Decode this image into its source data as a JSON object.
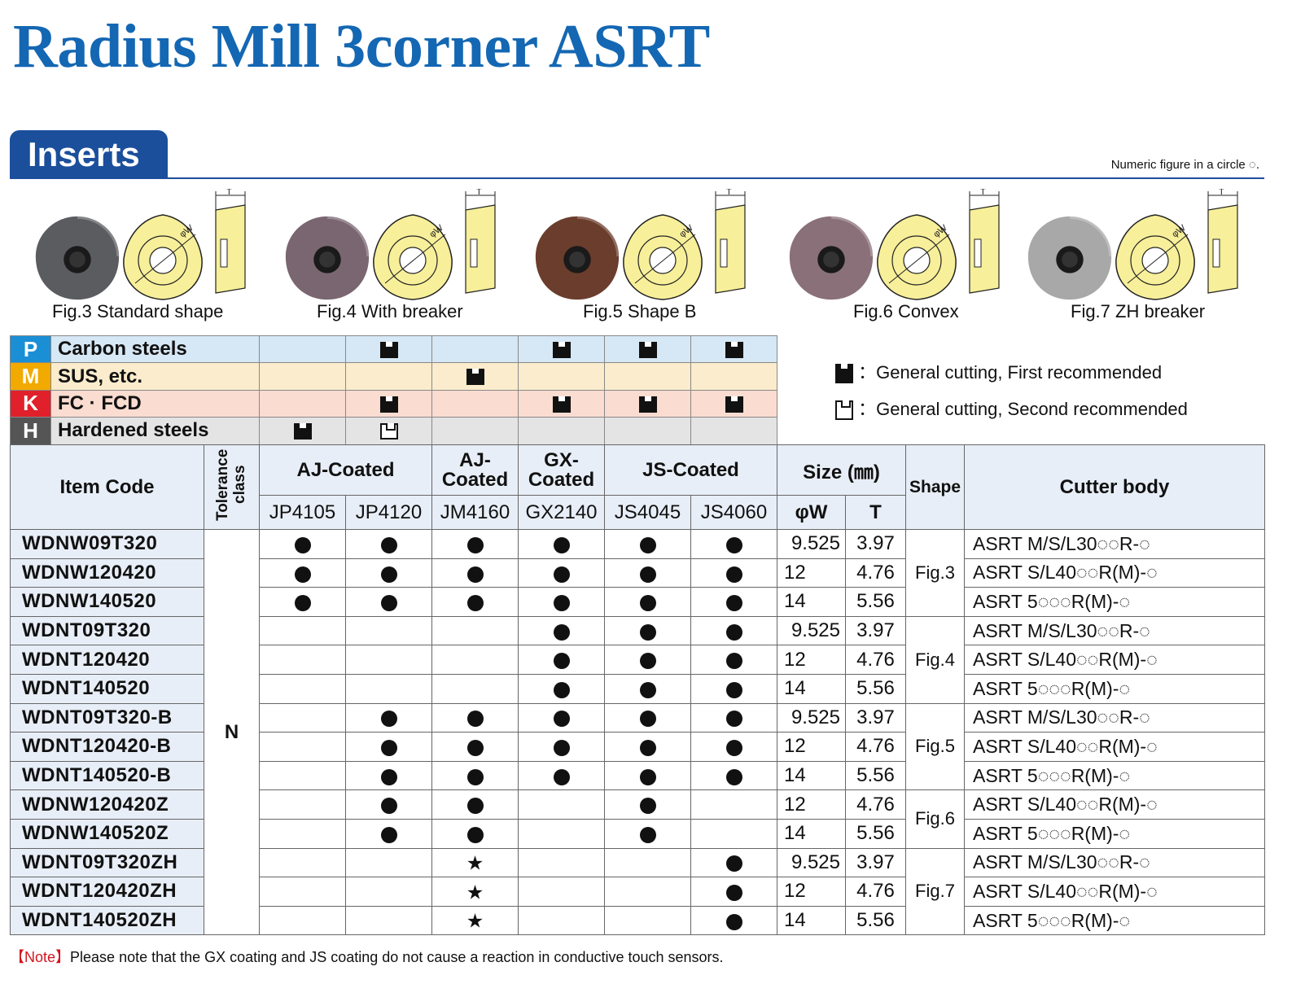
{
  "title": "Radius Mill 3corner ASRT",
  "section_tab": "Inserts",
  "circle_note": "Numeric figure in a circle ◌.",
  "figures": [
    {
      "caption": "Fig.3 Standard shape",
      "color": "#5a5c60"
    },
    {
      "caption": "Fig.4 With breaker",
      "color": "#7a6670"
    },
    {
      "caption": "Fig.5 Shape B",
      "color": "#6b3d2c"
    },
    {
      "caption": "Fig.6 Convex",
      "color": "#8a7078"
    },
    {
      "caption": "Fig.7 ZH breaker",
      "color": "#a8a8a8"
    }
  ],
  "figure_labels": {
    "t": "T",
    "w": "φW"
  },
  "materials": [
    {
      "letter": "P",
      "name": "Carbon steels",
      "letter_color": "#1a8fd6",
      "row_color": "#d6e7f5",
      "marks": [
        "",
        "1",
        "",
        "1",
        "1",
        "1"
      ]
    },
    {
      "letter": "M",
      "name": "SUS, etc.",
      "letter_color": "#f2a900",
      "row_color": "#fbeccd",
      "marks": [
        "",
        "",
        "1",
        "",
        "",
        ""
      ]
    },
    {
      "letter": "K",
      "name": "FC · FCD",
      "letter_color": "#e0202a",
      "row_color": "#fadcd0",
      "marks": [
        "",
        "1",
        "",
        "1",
        "1",
        "1"
      ]
    },
    {
      "letter": "H",
      "name": "Hardened steels",
      "letter_color": "#555555",
      "row_color": "#e4e4e4",
      "marks": [
        "1",
        "2",
        "",
        "",
        "",
        ""
      ]
    }
  ],
  "legend": [
    {
      "text": "：General cutting, First recommended"
    },
    {
      "text": "：General cutting, Second recommended"
    }
  ],
  "table_header": {
    "item_code": "Item  Code",
    "tolerance": "Tolerance class",
    "aj_coated": "AJ-Coated",
    "aj_coated_2": "AJ-Coated",
    "gx_coated": "GX-Coated",
    "js_coated": "JS-Coated",
    "size": "Size (㎜)",
    "shape": "Shape",
    "cutter_body": "Cutter body",
    "grades": [
      "JP4105",
      "JP4120",
      "JM4160",
      "GX2140",
      "JS4045",
      "JS4060"
    ],
    "w": "φW",
    "t": "T"
  },
  "tolerance_value": "N",
  "rows": [
    {
      "code": "WDNW09T320",
      "marks": [
        "●",
        "●",
        "●",
        "●",
        "●",
        "●"
      ],
      "w": "9.525",
      "t": "3.97",
      "body": "ASRT M/S/L30◌◌R-◌"
    },
    {
      "code": "WDNW120420",
      "marks": [
        "●",
        "●",
        "●",
        "●",
        "●",
        "●"
      ],
      "w": "12",
      "t": "4.76",
      "body": "ASRT S/L40◌◌R(M)-◌"
    },
    {
      "code": "WDNW140520",
      "marks": [
        "●",
        "●",
        "●",
        "●",
        "●",
        "●"
      ],
      "w": "14",
      "t": "5.56",
      "body": "ASRT 5◌◌◌R(M)-◌"
    },
    {
      "code": "WDNT09T320",
      "marks": [
        "",
        "",
        "",
        "●",
        "●",
        "●"
      ],
      "w": "9.525",
      "t": "3.97",
      "body": "ASRT M/S/L30◌◌R-◌"
    },
    {
      "code": "WDNT120420",
      "marks": [
        "",
        "",
        "",
        "●",
        "●",
        "●"
      ],
      "w": "12",
      "t": "4.76",
      "body": "ASRT S/L40◌◌R(M)-◌"
    },
    {
      "code": "WDNT140520",
      "marks": [
        "",
        "",
        "",
        "●",
        "●",
        "●"
      ],
      "w": "14",
      "t": "5.56",
      "body": "ASRT 5◌◌◌R(M)-◌"
    },
    {
      "code": "WDNT09T320-B",
      "marks": [
        "",
        "●",
        "●",
        "●",
        "●",
        "●"
      ],
      "w": "9.525",
      "t": "3.97",
      "body": "ASRT M/S/L30◌◌R-◌"
    },
    {
      "code": "WDNT120420-B",
      "marks": [
        "",
        "●",
        "●",
        "●",
        "●",
        "●"
      ],
      "w": "12",
      "t": "4.76",
      "body": "ASRT S/L40◌◌R(M)-◌"
    },
    {
      "code": "WDNT140520-B",
      "marks": [
        "",
        "●",
        "●",
        "●",
        "●",
        "●"
      ],
      "w": "14",
      "t": "5.56",
      "body": "ASRT 5◌◌◌R(M)-◌"
    },
    {
      "code": "WDNW120420Z",
      "marks": [
        "",
        "●",
        "●",
        "",
        "●",
        ""
      ],
      "w": "12",
      "t": "4.76",
      "body": "ASRT S/L40◌◌R(M)-◌"
    },
    {
      "code": "WDNW140520Z",
      "marks": [
        "",
        "●",
        "●",
        "",
        "●",
        ""
      ],
      "w": "14",
      "t": "5.56",
      "body": "ASRT 5◌◌◌R(M)-◌"
    },
    {
      "code": "WDNT09T320ZH",
      "marks": [
        "",
        "",
        "★",
        "",
        "",
        "●"
      ],
      "w": "9.525",
      "t": "3.97",
      "body": "ASRT M/S/L30◌◌R-◌"
    },
    {
      "code": "WDNT120420ZH",
      "marks": [
        "",
        "",
        "★",
        "",
        "",
        "●"
      ],
      "w": "12",
      "t": "4.76",
      "body": "ASRT S/L40◌◌R(M)-◌"
    },
    {
      "code": "WDNT140520ZH",
      "marks": [
        "",
        "",
        "★",
        "",
        "",
        "●"
      ],
      "w": "14",
      "t": "5.56",
      "body": "ASRT 5◌◌◌R(M)-◌"
    }
  ],
  "shape_groups": [
    {
      "label": "Fig.3",
      "span": 3
    },
    {
      "label": "Fig.4",
      "span": 3
    },
    {
      "label": "Fig.5",
      "span": 3
    },
    {
      "label": "Fig.6",
      "span": 2
    },
    {
      "label": "Fig.7",
      "span": 3
    }
  ],
  "note": {
    "tag": "【Note】",
    "text": "Please note that the GX coating and JS coating do not cause a reaction in conductive touch sensors."
  }
}
